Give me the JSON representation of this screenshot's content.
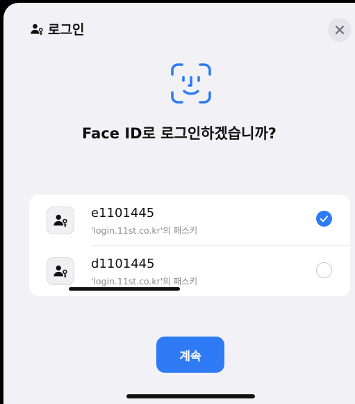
{
  "header": {
    "title": "로그인",
    "close_icon": "close-icon",
    "title_icon": "person-key-icon"
  },
  "prompt": {
    "icon": "face-id-icon",
    "question": "Face ID로 로그인하겠습니까?"
  },
  "accounts": [
    {
      "name": "e1101445",
      "subtitle": "'login.11st.co.kr'의 패스키",
      "selected": true,
      "icon": "person-key-icon"
    },
    {
      "name": "d1101445",
      "subtitle": "'login.11st.co.kr'의 패스키",
      "selected": false,
      "icon": "person-key-icon"
    }
  ],
  "actions": {
    "continue_label": "계속"
  },
  "colors": {
    "accent": "#2f7bf5",
    "sheet_background": "#f2f2f6",
    "card_background": "#ffffff"
  }
}
